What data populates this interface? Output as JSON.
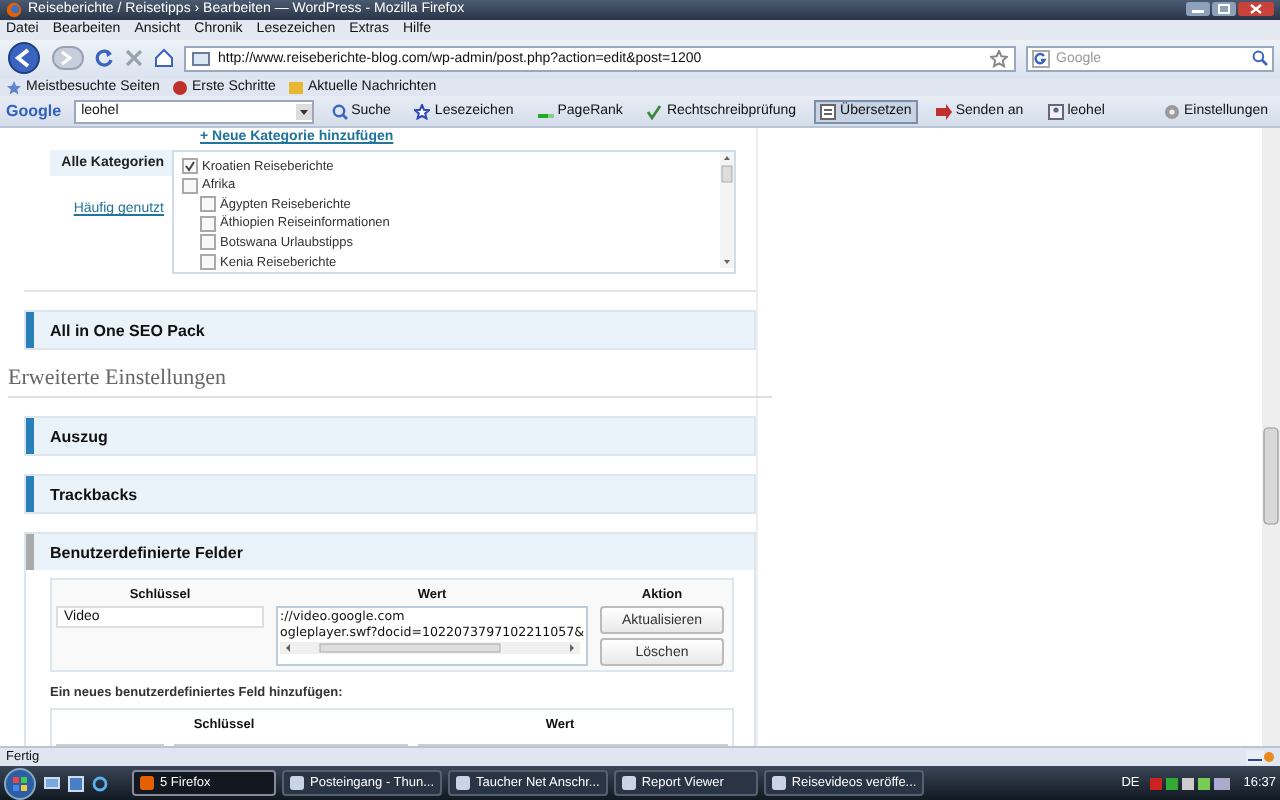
{
  "window": {
    "title": "Reiseberichte / Reisetipps › Bearbeiten — WordPress - Mozilla Firefox"
  },
  "menu": [
    "Datei",
    "Bearbeiten",
    "Ansicht",
    "Chronik",
    "Lesezeichen",
    "Extras",
    "Hilfe"
  ],
  "navbar": {
    "url": "http://www.reiseberichte-blog.com/wp-admin/post.php?action=edit&post=1200",
    "search_placeholder": "Google"
  },
  "bookmarks": [
    {
      "label": "Meistbesuchte Seiten",
      "kind": "star"
    },
    {
      "label": "Erste Schritte",
      "kind": "flag"
    },
    {
      "label": "Aktuelle Nachrichten",
      "kind": "feed"
    }
  ],
  "google_toolbar": {
    "logo": "Google",
    "query": "leohel",
    "items": [
      {
        "label": "Suche",
        "kind": "search",
        "selected": false
      },
      {
        "label": "Lesezeichen",
        "kind": "star",
        "selected": false
      },
      {
        "label": "PageRank",
        "kind": "pagerank",
        "selected": false
      },
      {
        "label": "Rechtschreibprüfung",
        "kind": "spell",
        "selected": false
      },
      {
        "label": "Übersetzen",
        "kind": "translate",
        "selected": true
      },
      {
        "label": "Senden an",
        "kind": "send",
        "selected": false
      },
      {
        "label": "leohel",
        "kind": "user",
        "selected": false
      },
      {
        "label": "Einstellungen",
        "kind": "settings",
        "selected": false
      }
    ]
  },
  "content": {
    "new_category_link": "+ Neue Kategorie hinzufügen",
    "category_tabs": [
      {
        "label": "Alle Kategorien",
        "selected": true
      },
      {
        "label": "Häufig genutzt",
        "selected": false
      }
    ],
    "categories": [
      {
        "label": "Kroatien Reiseberichte",
        "checked": true
      },
      {
        "label": "Afrika",
        "checked": false,
        "children": [
          {
            "label": "Ägypten Reiseberichte",
            "checked": false
          },
          {
            "label": "Äthiopien Reiseinformationen",
            "checked": false
          },
          {
            "label": "Botswana Urlaubstipps",
            "checked": false
          },
          {
            "label": "Kenia Reiseberichte",
            "checked": false
          }
        ]
      }
    ],
    "top_boxes": [
      {
        "title": "All in One SEO Pack",
        "expanded": false
      }
    ],
    "advanced_heading": "Erweiterte Einstellungen",
    "advanced_boxes": [
      {
        "title": "Auszug",
        "expanded": false
      },
      {
        "title": "Trackbacks",
        "expanded": false
      },
      {
        "title": "Benutzerdefinierte Felder",
        "expanded": true
      }
    ],
    "custom_fields": {
      "columns": [
        "Schlüssel",
        "Wert",
        "Aktion"
      ],
      "key": "Video",
      "value_lines": [
        "://video.google.com",
        "ogleplayer.swf?docid=1022073797102211057&"
      ],
      "buttons": [
        "Aktualisieren",
        "Löschen"
      ],
      "new_field_label": "Ein neues benutzerdefiniertes Feld hinzufügen:",
      "new_columns": [
        "Schlüssel",
        "Wert"
      ]
    }
  },
  "status_bar": {
    "text": "Fertig"
  },
  "taskbar": {
    "buttons": [
      {
        "label": "5 Firefox",
        "selected": true
      },
      {
        "label": "Posteingang - Thun...",
        "selected": false
      },
      {
        "label": "Taucher Net Anschr...",
        "selected": false
      },
      {
        "label": "Report Viewer",
        "selected": false
      },
      {
        "label": "Reisevideos veröffe...",
        "selected": false
      }
    ],
    "language": "DE",
    "clock": "16:37"
  }
}
